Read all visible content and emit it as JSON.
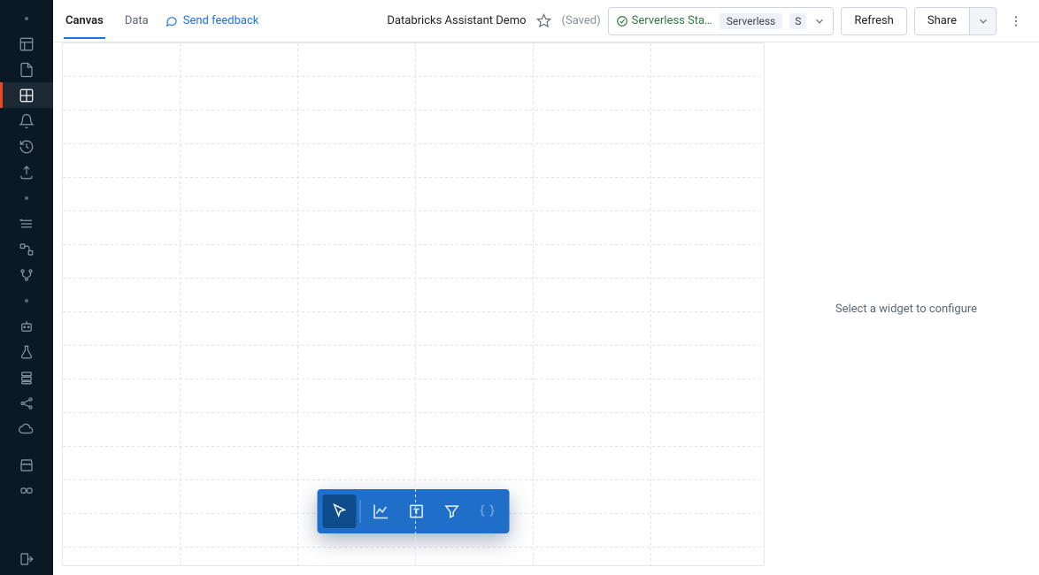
{
  "header": {
    "tabs": [
      {
        "label": "Canvas",
        "active": true
      },
      {
        "label": "Data",
        "active": false
      }
    ],
    "feedback_label": "Send feedback",
    "page_title": "Databricks Assistant Demo",
    "saved_label": "(Saved)",
    "cluster": {
      "status_label": "Serverless Sta…",
      "chip_primary": "Serverless",
      "chip_secondary": "S"
    },
    "refresh_label": "Refresh",
    "share_label": "Share"
  },
  "right_panel": {
    "hint": "Select a widget to configure"
  },
  "floating_toolbar": {
    "tools": [
      {
        "name": "pointer",
        "selected": true
      },
      {
        "name": "chart",
        "selected": false
      },
      {
        "name": "text",
        "selected": false
      },
      {
        "name": "filter",
        "selected": false
      },
      {
        "name": "code",
        "selected": false
      }
    ]
  },
  "sidebar": {
    "groups": [
      {
        "items": [
          "home",
          "new-tab",
          "editor-active",
          "alerts",
          "history",
          "data"
        ]
      },
      {
        "items": [
          "tasks",
          "pipelines",
          "ml"
        ]
      },
      {
        "items": [
          "apps",
          "experiments",
          "models",
          "share",
          "cloud"
        ]
      },
      {
        "items": [
          "marketplace",
          "partner"
        ]
      }
    ],
    "footer": "logout"
  }
}
